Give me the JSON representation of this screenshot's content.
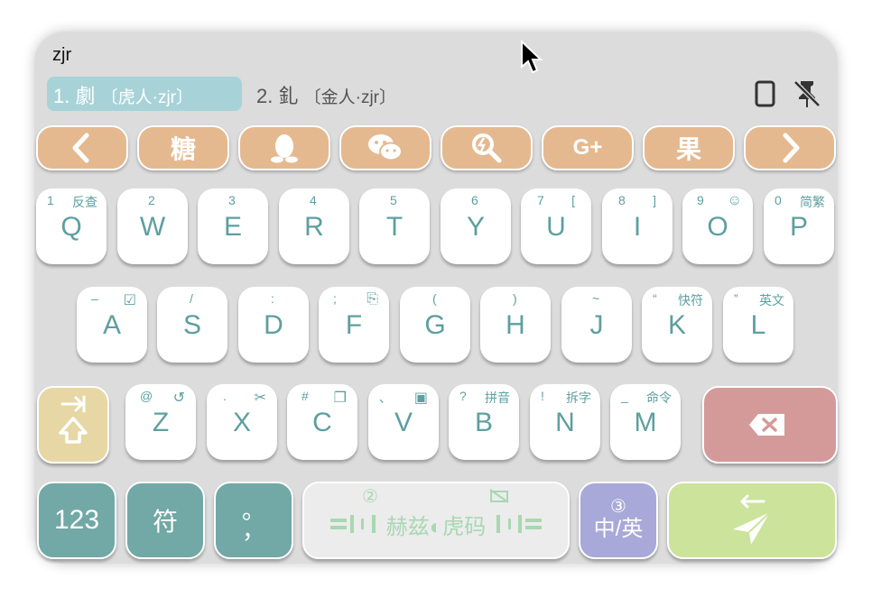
{
  "input": {
    "pinyin": "zjr"
  },
  "candidates": [
    {
      "index": "1.",
      "char": "劇",
      "code": "〔虎人·zjr〕"
    },
    {
      "index": "2.",
      "char": "釓",
      "code": "〔金人·zjr〕"
    }
  ],
  "toolbar": {
    "buttons": [
      {
        "name": "back",
        "icon": "chevron-left-icon"
      },
      {
        "name": "candy",
        "label": "糖"
      },
      {
        "name": "qq",
        "icon": "penguin-icon"
      },
      {
        "name": "wechat",
        "icon": "wechat-icon"
      },
      {
        "name": "search",
        "icon": "search-icon"
      },
      {
        "name": "google-plus",
        "icon": "google-plus-icon"
      },
      {
        "name": "fruit",
        "label": "果"
      },
      {
        "name": "forward",
        "icon": "chevron-right-icon"
      }
    ],
    "google_plus_label": "G+"
  },
  "rows": {
    "row1": [
      {
        "main": "Q",
        "sub_left": "1",
        "sub_right": "反查"
      },
      {
        "main": "W",
        "sub_left": "2",
        "sub_right": ""
      },
      {
        "main": "E",
        "sub_left": "3",
        "sub_right": ""
      },
      {
        "main": "R",
        "sub_left": "4",
        "sub_right": ""
      },
      {
        "main": "T",
        "sub_left": "5",
        "sub_right": ""
      },
      {
        "main": "Y",
        "sub_left": "6",
        "sub_right": ""
      },
      {
        "main": "U",
        "sub_left": "7",
        "sub_right": "["
      },
      {
        "main": "I",
        "sub_left": "8",
        "sub_right": "]"
      },
      {
        "main": "O",
        "sub_left": "9",
        "sub_right": "☺"
      },
      {
        "main": "P",
        "sub_left": "0",
        "sub_right": "简繁"
      }
    ],
    "row2": [
      {
        "main": "A",
        "sub_left": "–",
        "sub_right": "☑"
      },
      {
        "main": "S",
        "sub_left": "/",
        "sub_right": ""
      },
      {
        "main": "D",
        "sub_left": ":",
        "sub_right": ""
      },
      {
        "main": "F",
        "sub_left": ";",
        "sub_right": "⎘"
      },
      {
        "main": "G",
        "sub_left": "(",
        "sub_right": ""
      },
      {
        "main": "H",
        "sub_left": ")",
        "sub_right": ""
      },
      {
        "main": "J",
        "sub_left": "~",
        "sub_right": ""
      },
      {
        "main": "K",
        "sub_left": "“",
        "sub_right": "快符"
      },
      {
        "main": "L",
        "sub_left": "”",
        "sub_right": "英文"
      }
    ],
    "row3": [
      {
        "main": "Z",
        "sub_left": "@",
        "sub_right": "↺"
      },
      {
        "main": "X",
        "sub_left": ".",
        "sub_right": "✂"
      },
      {
        "main": "C",
        "sub_left": "#",
        "sub_right": "❐"
      },
      {
        "main": "V",
        "sub_left": "、",
        "sub_right": "▣"
      },
      {
        "main": "B",
        "sub_left": "?",
        "sub_right": "拼音"
      },
      {
        "main": "N",
        "sub_left": "!",
        "sub_right": "拆字"
      },
      {
        "main": "M",
        "sub_left": "_",
        "sub_right": "命令"
      }
    ]
  },
  "bottom": {
    "numbers_label": "123",
    "symbols_label": "符",
    "punct_label": "。\n，",
    "punct_top": "。",
    "punct_bottom": "，",
    "space_label": "赫兹◐虎码",
    "space_badge": "②",
    "lang_label": "中/英",
    "lang_badge": "③"
  },
  "colors": {
    "panel": "#dcdcdc",
    "key_text": "#5e9fa0",
    "toolbar": "#e5b990",
    "shift": "#e7d7a5",
    "backspace": "#d49a9a",
    "teal_key": "#72a8a6",
    "space": "#ececec",
    "space_text": "#a8d8b1",
    "lang": "#a8a9d8",
    "enter": "#cbe39a",
    "candidate_highlight": "#a7d3d8"
  }
}
